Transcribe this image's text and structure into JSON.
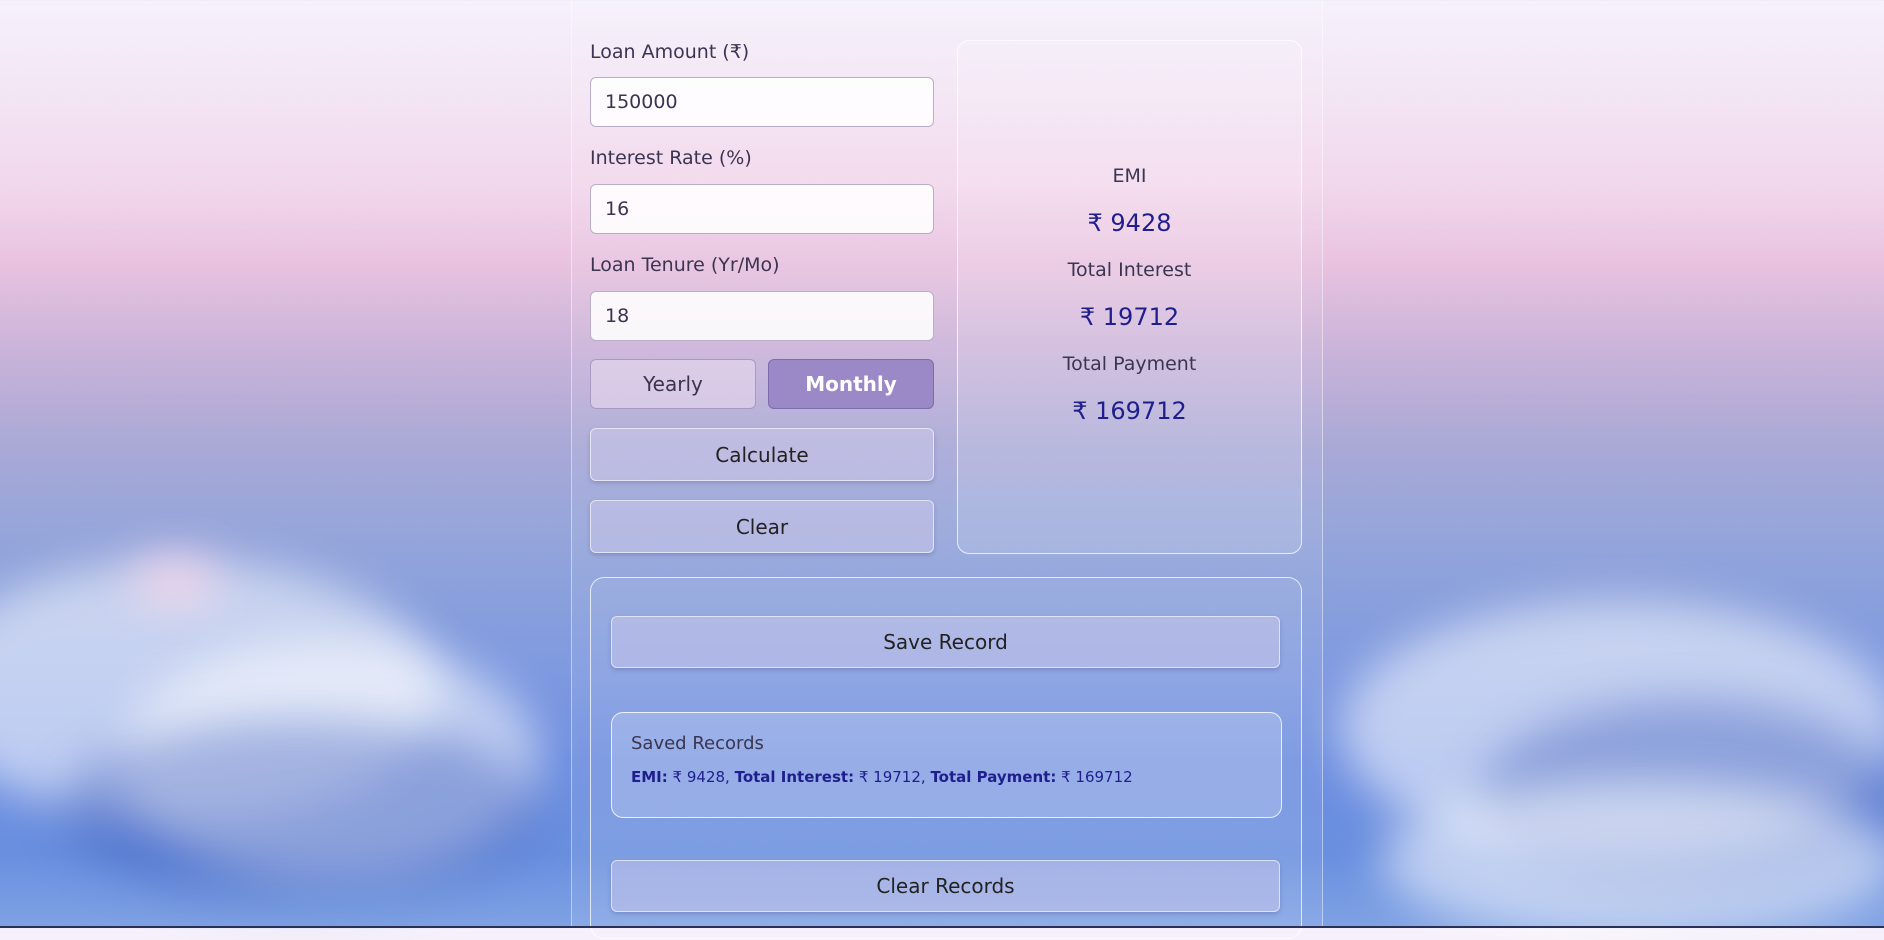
{
  "form": {
    "loan_amount_label": "Loan Amount (₹)",
    "loan_amount_value": "150000",
    "interest_rate_label": "Interest Rate (%)",
    "interest_rate_value": "16",
    "loan_tenure_label": "Loan Tenure (Yr/Mo)",
    "loan_tenure_value": "18",
    "tenure_mode_selected": "Monthly",
    "yearly_label": "Yearly",
    "monthly_label": "Monthly",
    "calculate_label": "Calculate",
    "clear_label": "Clear"
  },
  "results": {
    "emi_label": "EMI",
    "emi_value": "₹ 9428",
    "total_interest_label": "Total Interest",
    "total_interest_value": "₹ 19712",
    "total_payment_label": "Total Payment",
    "total_payment_value": "₹ 169712"
  },
  "records": {
    "save_label": "Save Record",
    "saved_title": "Saved Records",
    "items": [
      {
        "emi_key": "EMI:",
        "emi_value": "₹ 9428,",
        "interest_key": "Total Interest:",
        "interest_value": "₹ 19712,",
        "payment_key": "Total Payment:",
        "payment_value": "₹ 169712"
      }
    ],
    "clear_records_label": "Clear Records"
  },
  "colors": {
    "accent": "#9b88c6",
    "result_text": "#1f1e8c"
  }
}
